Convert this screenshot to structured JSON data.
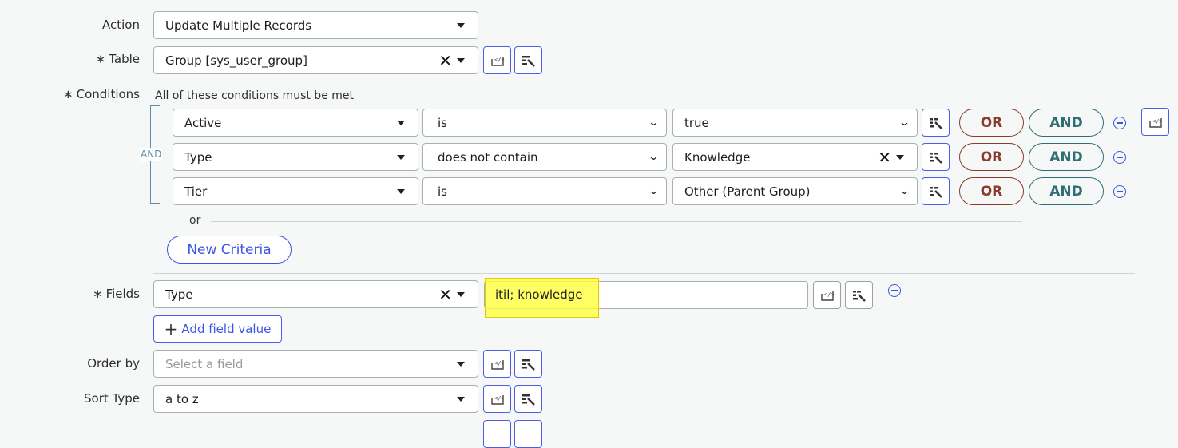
{
  "action": {
    "label": "Action",
    "value": "Update Multiple Records"
  },
  "table": {
    "label": "Table",
    "value": "Group [sys_user_group]"
  },
  "conditions": {
    "label": "Conditions",
    "hint": "All of these conditions must be met",
    "group_op": "AND",
    "rows": [
      {
        "field": "Active",
        "operator": "is",
        "value": "true",
        "clearable": false
      },
      {
        "field": "Type",
        "operator": "does not contain",
        "value": "Knowledge",
        "clearable": true
      },
      {
        "field": "Tier",
        "operator": "is",
        "value": "Other (Parent Group)",
        "clearable": false
      }
    ],
    "or_label": "OR",
    "and_label": "AND",
    "or_divider": "or",
    "new_criteria": "New Criteria"
  },
  "fields": {
    "label": "Fields",
    "field": "Type",
    "value": "itil; knowledge",
    "add_label": "Add field value"
  },
  "order_by": {
    "label": "Order by",
    "placeholder": "Select a field"
  },
  "sort_type": {
    "label": "Sort Type",
    "value": "a to z"
  },
  "required_mark": "∗",
  "colors": {
    "accent": "#4a5ee8",
    "or": "#8b3a2e",
    "and": "#2f6f73",
    "highlight": "#ffff66"
  }
}
